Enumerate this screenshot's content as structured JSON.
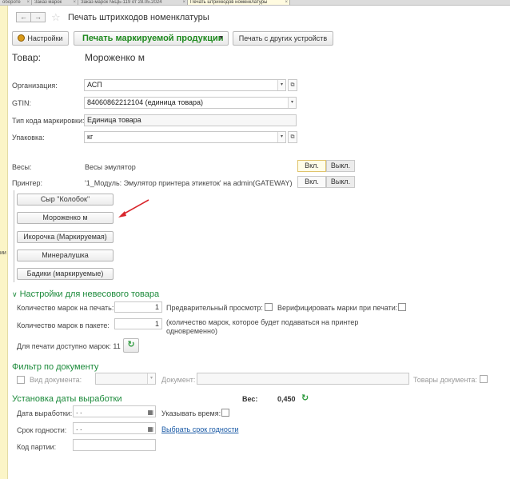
{
  "tabs": [
    {
      "label": "оборотe",
      "active": false
    },
    {
      "label": "Заказ марок",
      "active": false
    },
    {
      "label": "Заказ марок №ЦБ-119 от 28.05.2024",
      "active": false
    },
    {
      "label": "Печать штрихкодов номенклатуры",
      "active": true
    }
  ],
  "left_strip_text": "ии",
  "nav": {
    "back": "←",
    "forward": "→"
  },
  "star": "☆",
  "title": "Печать штрихкодов номенклатуры",
  "toolbar": {
    "settings": "Настройки",
    "print_marked": "Печать маркируемой продукции",
    "print_other": "Печать с других устройств"
  },
  "product": {
    "label": "Товар:",
    "value": "Мороженко м"
  },
  "form": {
    "org_label": "Организация:",
    "org_value": "АСП",
    "gtin_label": "GTIN:",
    "gtin_value": "84060862212104 (единица товара)",
    "code_type_label": "Тип кода маркировки:",
    "code_type_value": "Единица товара",
    "pack_label": "Упаковка:",
    "pack_value": "кг",
    "scales_label": "Весы:",
    "scales_value": "Весы эмулятор",
    "printer_label": "Принтер:",
    "printer_value": "'1_Модуль: Эмулятор принтера этикеток' на admin(GATEWAY)",
    "on": "Вкл.",
    "off": "Выкл."
  },
  "products": [
    "Сыр \"Колобок\"",
    "Мороженко м",
    "Икорочка (Маркируемая)",
    "Минералушка",
    "Бадики (маркируемые)"
  ],
  "nonweight": {
    "title": "Настройки для невесового товара",
    "count_label": "Количество марок на печать:",
    "count_value": "1",
    "preview_label": "Предварительный просмотр:",
    "verify_label": "Верифицировать марки при печати:",
    "pack_count_label": "Количество марок в пакете:",
    "pack_count_value": "1",
    "pack_note_1": "(количество марок, которое будет подаваться на принтер",
    "pack_note_2": "одновременно)",
    "available_label": "Для печати доступно марок: 11"
  },
  "doc_filter": {
    "title": "Фильтр по документу",
    "doc_type_label": "Вид документа:",
    "doc_label": "Документ:",
    "doc_goods_label": "Товары документа:"
  },
  "production": {
    "title": "Установка даты выработки",
    "weight_label": "Вес:",
    "weight_value": "0,450",
    "date_label": "Дата выработки:",
    "date_value": " .  .",
    "show_time_label": "Указывать время:",
    "expiry_label": "Срок годности:",
    "expiry_value": " .  .",
    "choose_expiry": "Выбрать срок годности",
    "batch_label": "Код партии:"
  },
  "colors": {
    "accent_green": "#1b8a3a",
    "link_blue": "#1a5aa6",
    "arrow_red": "#d9262c"
  }
}
